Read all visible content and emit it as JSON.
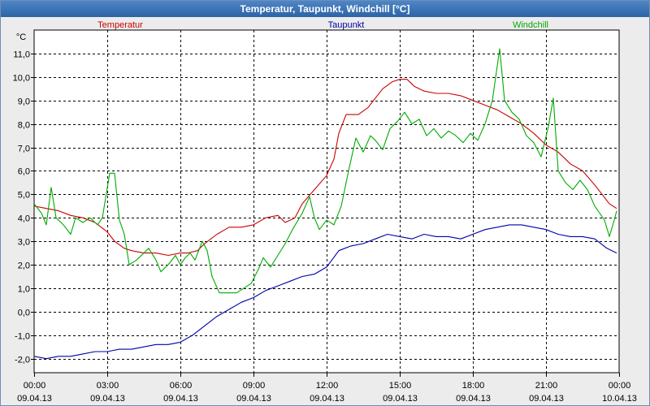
{
  "window": {
    "title": "Temperatur, Taupunkt, Windchill [°C]"
  },
  "colors": {
    "Temperatur": "#cc0000",
    "Taupunkt": "#0000aa",
    "Windchill": "#00aa00",
    "grid": "#000000",
    "plot_bg": "#ffffff"
  },
  "chart_data": {
    "type": "line",
    "title": "Temperatur, Taupunkt, Windchill [°C]",
    "ylabel": "°C",
    "xlabel": "",
    "ylim": [
      -2.6,
      12.0
    ],
    "xlim": [
      0,
      24
    ],
    "grid": true,
    "legend_position": "top",
    "y_ticks": [
      -2.0,
      -1.0,
      0.0,
      1.0,
      2.0,
      3.0,
      4.0,
      5.0,
      6.0,
      7.0,
      8.0,
      9.0,
      10.0,
      11.0
    ],
    "y_tick_labels": [
      "-2,0",
      "-1,0",
      "0,0",
      "1,0",
      "2,0",
      "3,0",
      "4,0",
      "5,0",
      "6,0",
      "7,0",
      "8,0",
      "9,0",
      "10,0",
      "11,0"
    ],
    "x_ticks": [
      0,
      3,
      6,
      9,
      12,
      15,
      18,
      21,
      24
    ],
    "x_tick_times": [
      "00:00",
      "03:00",
      "06:00",
      "09:00",
      "12:00",
      "15:00",
      "18:00",
      "21:00",
      "00:00"
    ],
    "x_tick_dates": [
      "09.04.13",
      "09.04.13",
      "09.04.13",
      "09.04.13",
      "09.04.13",
      "09.04.13",
      "09.04.13",
      "09.04.13",
      "10.04.13"
    ],
    "series": [
      {
        "name": "Temperatur",
        "points": [
          [
            0,
            4.5
          ],
          [
            0.5,
            4.4
          ],
          [
            1,
            4.3
          ],
          [
            1.5,
            4.1
          ],
          [
            2,
            4.0
          ],
          [
            2.5,
            3.8
          ],
          [
            3,
            3.4
          ],
          [
            3.3,
            3.0
          ],
          [
            3.7,
            2.7
          ],
          [
            4,
            2.6
          ],
          [
            4.5,
            2.5
          ],
          [
            5,
            2.5
          ],
          [
            5.5,
            2.4
          ],
          [
            6,
            2.5
          ],
          [
            6.3,
            2.5
          ],
          [
            6.7,
            2.6
          ],
          [
            7,
            2.9
          ],
          [
            7.5,
            3.3
          ],
          [
            8,
            3.6
          ],
          [
            8.5,
            3.6
          ],
          [
            9,
            3.7
          ],
          [
            9.5,
            4.0
          ],
          [
            10,
            4.1
          ],
          [
            10.3,
            3.8
          ],
          [
            10.7,
            4.0
          ],
          [
            11,
            4.6
          ],
          [
            11.5,
            5.2
          ],
          [
            12,
            5.8
          ],
          [
            12.3,
            6.5
          ],
          [
            12.5,
            7.6
          ],
          [
            12.8,
            8.4
          ],
          [
            13.3,
            8.4
          ],
          [
            13.7,
            8.7
          ],
          [
            14,
            9.1
          ],
          [
            14.3,
            9.5
          ],
          [
            14.7,
            9.8
          ],
          [
            15,
            9.9
          ],
          [
            15.3,
            9.9
          ],
          [
            15.6,
            9.6
          ],
          [
            16,
            9.4
          ],
          [
            16.5,
            9.3
          ],
          [
            17,
            9.3
          ],
          [
            17.5,
            9.2
          ],
          [
            18,
            9.0
          ],
          [
            18.5,
            8.8
          ],
          [
            19,
            8.6
          ],
          [
            19.5,
            8.3
          ],
          [
            20,
            8.0
          ],
          [
            20.5,
            7.6
          ],
          [
            21,
            7.1
          ],
          [
            21.5,
            6.8
          ],
          [
            22,
            6.3
          ],
          [
            22.5,
            6.0
          ],
          [
            23,
            5.4
          ],
          [
            23.3,
            5.0
          ],
          [
            23.6,
            4.6
          ],
          [
            23.9,
            4.4
          ]
        ]
      },
      {
        "name": "Taupunkt",
        "points": [
          [
            0,
            -1.9
          ],
          [
            0.5,
            -2.0
          ],
          [
            1,
            -1.9
          ],
          [
            1.5,
            -1.9
          ],
          [
            2,
            -1.8
          ],
          [
            2.5,
            -1.7
          ],
          [
            3,
            -1.7
          ],
          [
            3.5,
            -1.6
          ],
          [
            4,
            -1.6
          ],
          [
            4.5,
            -1.5
          ],
          [
            5,
            -1.4
          ],
          [
            5.5,
            -1.4
          ],
          [
            6,
            -1.3
          ],
          [
            6.5,
            -1.0
          ],
          [
            7,
            -0.6
          ],
          [
            7.5,
            -0.2
          ],
          [
            8,
            0.1
          ],
          [
            8.5,
            0.4
          ],
          [
            9,
            0.6
          ],
          [
            9.5,
            0.9
          ],
          [
            10,
            1.1
          ],
          [
            10.5,
            1.3
          ],
          [
            11,
            1.5
          ],
          [
            11.5,
            1.6
          ],
          [
            12,
            1.9
          ],
          [
            12.5,
            2.6
          ],
          [
            13,
            2.8
          ],
          [
            13.5,
            2.9
          ],
          [
            14,
            3.1
          ],
          [
            14.5,
            3.3
          ],
          [
            15,
            3.2
          ],
          [
            15.5,
            3.1
          ],
          [
            16,
            3.3
          ],
          [
            16.5,
            3.2
          ],
          [
            17,
            3.2
          ],
          [
            17.5,
            3.1
          ],
          [
            18,
            3.3
          ],
          [
            18.5,
            3.5
          ],
          [
            19,
            3.6
          ],
          [
            19.5,
            3.7
          ],
          [
            20,
            3.7
          ],
          [
            20.5,
            3.6
          ],
          [
            21,
            3.5
          ],
          [
            21.5,
            3.3
          ],
          [
            22,
            3.2
          ],
          [
            22.5,
            3.2
          ],
          [
            23,
            3.1
          ],
          [
            23.5,
            2.7
          ],
          [
            23.9,
            2.5
          ]
        ]
      },
      {
        "name": "Windchill",
        "points": [
          [
            0,
            4.6
          ],
          [
            0.3,
            4.2
          ],
          [
            0.5,
            3.7
          ],
          [
            0.7,
            5.3
          ],
          [
            0.9,
            4.0
          ],
          [
            1.2,
            3.7
          ],
          [
            1.5,
            3.3
          ],
          [
            1.7,
            4.0
          ],
          [
            2,
            3.8
          ],
          [
            2.3,
            4.0
          ],
          [
            2.6,
            3.7
          ],
          [
            2.8,
            4.0
          ],
          [
            3.1,
            5.9
          ],
          [
            3.3,
            5.9
          ],
          [
            3.5,
            3.9
          ],
          [
            3.7,
            3.3
          ],
          [
            3.9,
            2.0
          ],
          [
            4.2,
            2.2
          ],
          [
            4.5,
            2.5
          ],
          [
            4.7,
            2.7
          ],
          [
            5,
            2.2
          ],
          [
            5.2,
            1.7
          ],
          [
            5.5,
            2.0
          ],
          [
            5.8,
            2.4
          ],
          [
            6,
            2.0
          ],
          [
            6.2,
            2.3
          ],
          [
            6.4,
            2.5
          ],
          [
            6.6,
            2.2
          ],
          [
            6.9,
            3.0
          ],
          [
            7.1,
            2.6
          ],
          [
            7.3,
            1.5
          ],
          [
            7.6,
            0.8
          ],
          [
            8,
            0.8
          ],
          [
            8.3,
            0.8
          ],
          [
            8.6,
            1.0
          ],
          [
            8.9,
            1.2
          ],
          [
            9.2,
            1.8
          ],
          [
            9.4,
            2.3
          ],
          [
            9.7,
            1.9
          ],
          [
            10,
            2.4
          ],
          [
            10.3,
            2.9
          ],
          [
            10.6,
            3.5
          ],
          [
            11,
            4.2
          ],
          [
            11.3,
            4.9
          ],
          [
            11.5,
            4.0
          ],
          [
            11.7,
            3.5
          ],
          [
            12,
            3.9
          ],
          [
            12.3,
            3.7
          ],
          [
            12.6,
            4.5
          ],
          [
            12.9,
            6.0
          ],
          [
            13.2,
            7.4
          ],
          [
            13.5,
            6.8
          ],
          [
            13.8,
            7.5
          ],
          [
            14,
            7.3
          ],
          [
            14.3,
            6.9
          ],
          [
            14.6,
            7.8
          ],
          [
            14.9,
            8.1
          ],
          [
            15.2,
            8.5
          ],
          [
            15.5,
            8.0
          ],
          [
            15.8,
            8.2
          ],
          [
            16.1,
            7.5
          ],
          [
            16.4,
            7.8
          ],
          [
            16.7,
            7.4
          ],
          [
            17,
            7.7
          ],
          [
            17.3,
            7.5
          ],
          [
            17.6,
            7.2
          ],
          [
            17.9,
            7.6
          ],
          [
            18.2,
            7.3
          ],
          [
            18.5,
            8.0
          ],
          [
            18.8,
            9.0
          ],
          [
            19.1,
            11.2
          ],
          [
            19.3,
            9.0
          ],
          [
            19.6,
            8.5
          ],
          [
            19.9,
            8.2
          ],
          [
            20.2,
            7.5
          ],
          [
            20.5,
            7.2
          ],
          [
            20.8,
            6.6
          ],
          [
            21.1,
            7.9
          ],
          [
            21.3,
            9.1
          ],
          [
            21.5,
            6.0
          ],
          [
            21.8,
            5.5
          ],
          [
            22.1,
            5.2
          ],
          [
            22.4,
            5.6
          ],
          [
            22.7,
            5.2
          ],
          [
            23,
            4.5
          ],
          [
            23.2,
            4.2
          ],
          [
            23.4,
            3.9
          ],
          [
            23.6,
            3.2
          ],
          [
            23.8,
            3.9
          ],
          [
            23.9,
            4.3
          ]
        ]
      }
    ]
  }
}
